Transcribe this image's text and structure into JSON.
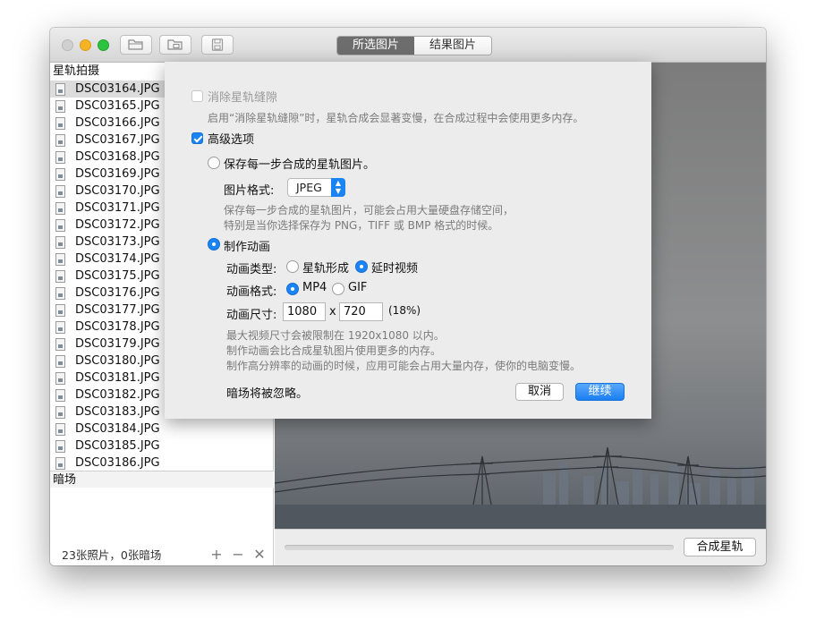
{
  "toolbar": {
    "tabs": [
      {
        "label": "所选图片",
        "active": true
      },
      {
        "label": "结果图片",
        "active": false
      }
    ],
    "icons": [
      "open-folder-icon",
      "output-folder-icon",
      "save-icon"
    ]
  },
  "sidebar": {
    "photos_header": "星轨拍摄",
    "files": [
      "DSC03164.JPG",
      "DSC03165.JPG",
      "DSC03166.JPG",
      "DSC03167.JPG",
      "DSC03168.JPG",
      "DSC03169.JPG",
      "DSC03170.JPG",
      "DSC03171.JPG",
      "DSC03172.JPG",
      "DSC03173.JPG",
      "DSC03174.JPG",
      "DSC03175.JPG",
      "DSC03176.JPG",
      "DSC03177.JPG",
      "DSC03178.JPG",
      "DSC03179.JPG",
      "DSC03180.JPG",
      "DSC03181.JPG",
      "DSC03182.JPG",
      "DSC03183.JPG",
      "DSC03184.JPG",
      "DSC03185.JPG",
      "DSC03186.JPG"
    ],
    "selected_index": 0,
    "darks_header": "暗场",
    "count_text": "23张照片，0张暗场",
    "add_label": "+",
    "remove_label": "−",
    "clear_label": "✕"
  },
  "bottom": {
    "stack_label": "合成星轨",
    "progress": 0
  },
  "sheet": {
    "gap_fill_label": "消除星轨缝隙",
    "gap_fill_checked": false,
    "gap_fill_note": "启用“消除星轨缝隙”时，星轨合成会显著变慢，在合成过程中会使用更多内存。",
    "advanced_label": "高级选项",
    "advanced_checked": true,
    "save_steps_label": "保存每一步合成的星轨图片。",
    "save_steps_selected": false,
    "image_format_label": "图片格式:",
    "image_format_value": "JPEG",
    "save_note_1": "保存每一步合成的星轨图片，可能会占用大量硬盘存储空间，",
    "save_note_2": "特别是当你选择保存为 PNG，TIFF 或 BMP 格式的时候。",
    "animation_label": "制作动画",
    "animation_selected": true,
    "anim_type_label": "动画类型:",
    "anim_type_options": [
      "星轨形成",
      "延时视频"
    ],
    "anim_type_selected": "延时视频",
    "anim_format_label": "动画格式:",
    "anim_format_options": [
      "MP4",
      "GIF"
    ],
    "anim_format_selected": "MP4",
    "anim_size_label": "动画尺寸:",
    "anim_width": "1080",
    "size_separator": "x",
    "anim_height": "720",
    "anim_percent": "(18%)",
    "anim_note_1": "最大视频尺寸会被限制在 1920x1080 以内。",
    "anim_note_2": "制作动画会比合成星轨图片使用更多的内存。",
    "anim_note_3": "制作高分辨率的动画的时候，应用可能会占用大量内存，使你的电脑变慢。",
    "darks_ignored": "暗场将被忽略。",
    "cancel_label": "取消",
    "continue_label": "继续"
  },
  "colors": {
    "accent": "#1b84f5",
    "active_tab": "#6d6d6d",
    "min_light": "#f5b324",
    "max_light": "#2ec33f"
  }
}
